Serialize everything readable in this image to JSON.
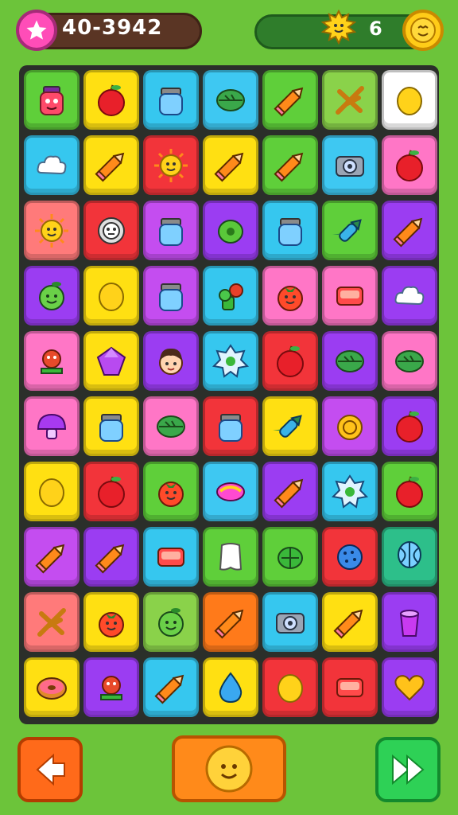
{
  "hud": {
    "score": "40-3942",
    "sun_count": "6",
    "icons": {
      "left": "star-icon",
      "sun": "sun-creature-icon",
      "right": "coin-face-icon"
    }
  },
  "palette": {
    "green": "#5fcf3a",
    "yellow": "#ffe012",
    "blue": "#3ec8f2",
    "red": "#f2343a",
    "purple": "#9b3df2",
    "pink": "#ff76c6",
    "white": "#ffffff",
    "lightblue": "#36c7ef",
    "orange": "#ff7a1a",
    "teal": "#2dbf8a",
    "lavender": "#c44df0",
    "lime": "#8ad24a",
    "salmon": "#ff7a7a"
  },
  "grid": [
    [
      {
        "bg": "green",
        "icon": "jar-face"
      },
      {
        "bg": "yellow",
        "icon": "apple"
      },
      {
        "bg": "lightblue",
        "icon": "jar"
      },
      {
        "bg": "blue",
        "icon": "leaf"
      },
      {
        "bg": "green",
        "icon": "pencil"
      },
      {
        "bg": "lime",
        "icon": "sticks"
      },
      {
        "bg": "white",
        "icon": "lemon"
      }
    ],
    [
      {
        "bg": "lightblue",
        "icon": "cloud"
      },
      {
        "bg": "yellow",
        "icon": "pencil"
      },
      {
        "bg": "red",
        "icon": "sun-face"
      },
      {
        "bg": "yellow",
        "icon": "pencil"
      },
      {
        "bg": "green",
        "icon": "pencil"
      },
      {
        "bg": "blue",
        "icon": "camera"
      },
      {
        "bg": "pink",
        "icon": "apple"
      }
    ],
    [
      {
        "bg": "salmon",
        "icon": "sun-face"
      },
      {
        "bg": "red",
        "icon": "robot"
      },
      {
        "bg": "lavender",
        "icon": "jar"
      },
      {
        "bg": "purple",
        "icon": "lime"
      },
      {
        "bg": "lightblue",
        "icon": "jar"
      },
      {
        "bg": "green",
        "icon": "rocket"
      },
      {
        "bg": "purple",
        "icon": "pencil"
      }
    ],
    [
      {
        "bg": "purple",
        "icon": "lime-face"
      },
      {
        "bg": "yellow",
        "icon": "lemon"
      },
      {
        "bg": "lavender",
        "icon": "jar"
      },
      {
        "bg": "lightblue",
        "icon": "sprout"
      },
      {
        "bg": "pink",
        "icon": "tomato"
      },
      {
        "bg": "pink",
        "icon": "box"
      },
      {
        "bg": "purple",
        "icon": "cloud"
      }
    ],
    [
      {
        "bg": "pink",
        "icon": "creature"
      },
      {
        "bg": "yellow",
        "icon": "gem"
      },
      {
        "bg": "purple",
        "icon": "face"
      },
      {
        "bg": "lightblue",
        "icon": "badge"
      },
      {
        "bg": "red",
        "icon": "apple"
      },
      {
        "bg": "purple",
        "icon": "leaf"
      },
      {
        "bg": "pink",
        "icon": "leaf"
      }
    ],
    [
      {
        "bg": "pink",
        "icon": "mushroom"
      },
      {
        "bg": "yellow",
        "icon": "jar"
      },
      {
        "bg": "pink",
        "icon": "leaf"
      },
      {
        "bg": "red",
        "icon": "jar"
      },
      {
        "bg": "yellow",
        "icon": "rocket"
      },
      {
        "bg": "lavender",
        "icon": "coin"
      },
      {
        "bg": "purple",
        "icon": "apple"
      }
    ],
    [
      {
        "bg": "yellow",
        "icon": "lemon"
      },
      {
        "bg": "red",
        "icon": "apple"
      },
      {
        "bg": "green",
        "icon": "tomato"
      },
      {
        "bg": "blue",
        "icon": "candy"
      },
      {
        "bg": "purple",
        "icon": "pencil"
      },
      {
        "bg": "lightblue",
        "icon": "badge"
      },
      {
        "bg": "green",
        "icon": "apple"
      }
    ],
    [
      {
        "bg": "lavender",
        "icon": "pencil"
      },
      {
        "bg": "purple",
        "icon": "pencil"
      },
      {
        "bg": "lightblue",
        "icon": "box"
      },
      {
        "bg": "green",
        "icon": "tooth"
      },
      {
        "bg": "green",
        "icon": "turtle"
      },
      {
        "bg": "red",
        "icon": "ball"
      },
      {
        "bg": "teal",
        "icon": "balloon"
      }
    ],
    [
      {
        "bg": "salmon",
        "icon": "sticks"
      },
      {
        "bg": "yellow",
        "icon": "tomato"
      },
      {
        "bg": "lime",
        "icon": "lime-face"
      },
      {
        "bg": "orange",
        "icon": "pencil"
      },
      {
        "bg": "lightblue",
        "icon": "camera"
      },
      {
        "bg": "yellow",
        "icon": "pencil"
      },
      {
        "bg": "purple",
        "icon": "cup"
      }
    ],
    [
      {
        "bg": "yellow",
        "icon": "donut"
      },
      {
        "bg": "purple",
        "icon": "creature"
      },
      {
        "bg": "lightblue",
        "icon": "pencil"
      },
      {
        "bg": "yellow",
        "icon": "drop"
      },
      {
        "bg": "red",
        "icon": "lemon"
      },
      {
        "bg": "red",
        "icon": "box"
      },
      {
        "bg": "purple",
        "icon": "heart"
      }
    ]
  ],
  "controls": {
    "back": "back-arrow-icon",
    "center": "hint-face-icon",
    "forward": "fast-forward-icon"
  }
}
